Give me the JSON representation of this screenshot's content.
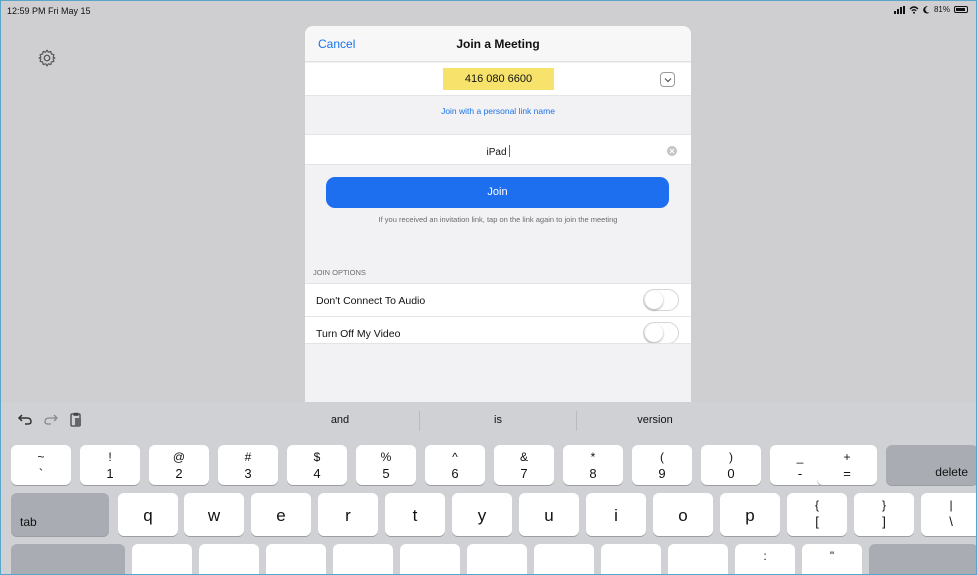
{
  "status_bar": {
    "time": "12:59 PM  Fri May 15",
    "battery": "81%"
  },
  "modal": {
    "cancel_label": "Cancel",
    "title": "Join a Meeting",
    "meeting_id": "416 080 6600",
    "personal_link_label": "Join with a personal link name",
    "name_value": "iPad",
    "join_label": "Join",
    "invite_hint": "If you received an invitation link, tap on the link again to join the meeting",
    "options_title": "JOIN OPTIONS",
    "options": [
      {
        "label": "Don't Connect To Audio",
        "on": false
      },
      {
        "label": "Turn Off My Video",
        "on": false
      }
    ]
  },
  "keyboard": {
    "suggestions": [
      "and",
      "is",
      "version"
    ],
    "number_row": [
      {
        "top": "~",
        "bottom": "`"
      },
      {
        "top": "!",
        "bottom": "1"
      },
      {
        "top": "@",
        "bottom": "2"
      },
      {
        "top": "#",
        "bottom": "3"
      },
      {
        "top": "$",
        "bottom": "4"
      },
      {
        "top": "%",
        "bottom": "5"
      },
      {
        "top": "^",
        "bottom": "6"
      },
      {
        "top": "&",
        "bottom": "7"
      },
      {
        "top": "*",
        "bottom": "8"
      },
      {
        "top": "(",
        "bottom": "9"
      },
      {
        "top": ")",
        "bottom": "0"
      },
      {
        "top": "_",
        "bottom": "-"
      },
      {
        "top": "+",
        "bottom": "="
      }
    ],
    "delete_label": "delete",
    "tab_label": "tab",
    "letter_row": [
      "q",
      "w",
      "e",
      "r",
      "t",
      "y",
      "u",
      "i",
      "o",
      "p"
    ],
    "bracket_keys": [
      {
        "top": "{",
        "bottom": "["
      },
      {
        "top": "}",
        "bottom": "]"
      },
      {
        "top": "|",
        "bottom": "\\"
      }
    ],
    "partial_row": [
      ":",
      "\""
    ]
  },
  "colors": {
    "accent": "#1d6ff0",
    "highlight": "#f7e36b"
  },
  "icons": [
    "gear-icon",
    "undo-icon",
    "redo-icon",
    "paste-icon",
    "chevron-down-icon",
    "clear-icon",
    "cellular-icon",
    "wifi-icon",
    "battery-icon"
  ]
}
